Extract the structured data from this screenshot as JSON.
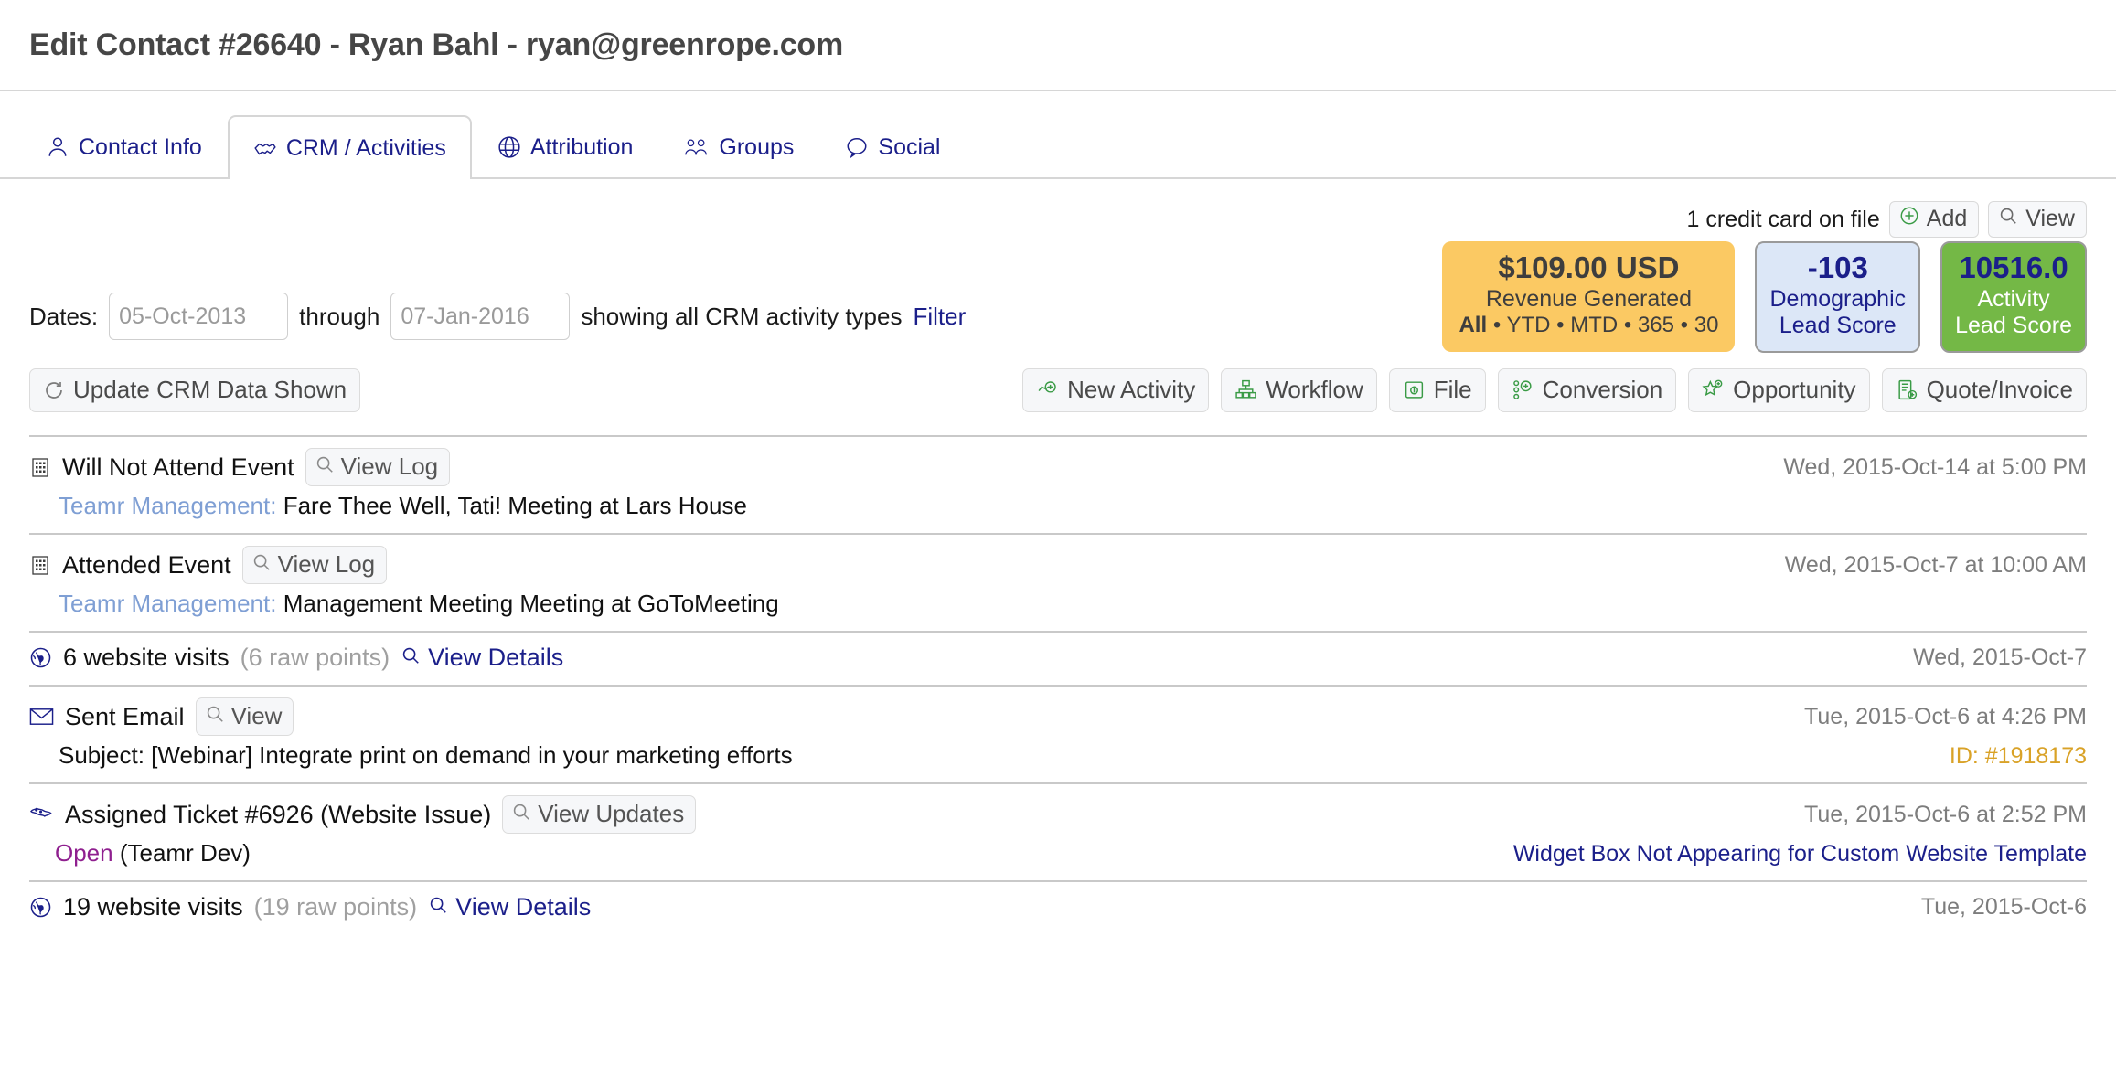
{
  "header": {
    "title": "Edit Contact #26640 - Ryan Bahl - ryan@greenrope.com"
  },
  "tabs": [
    {
      "label": "Contact Info",
      "icon": "person-icon",
      "active": false
    },
    {
      "label": "CRM / Activities",
      "icon": "handshake-icon",
      "active": true
    },
    {
      "label": "Attribution",
      "icon": "globe-icon",
      "active": false
    },
    {
      "label": "Groups",
      "icon": "people-icon",
      "active": false
    },
    {
      "label": "Social",
      "icon": "speech-bubble-icon",
      "active": false
    }
  ],
  "credit_card": {
    "text": "1 credit card on file",
    "add_label": "Add",
    "view_label": "View"
  },
  "dates": {
    "label": "Dates:",
    "from_value": "05-Oct-2013",
    "through_label": "through",
    "to_value": "07-Jan-2016",
    "showing_text": "showing all CRM activity types",
    "filter_label": "Filter"
  },
  "badges": {
    "revenue": {
      "amount": "$109.00 USD",
      "caption": "Revenue Generated",
      "ranges": [
        "All",
        "YTD",
        "MTD",
        "365",
        "30"
      ],
      "separator": "•",
      "bg": "#fbc963"
    },
    "demographic": {
      "value": "-103",
      "line1": "Demographic",
      "line2": "Lead Score",
      "bg": "#dce7f7"
    },
    "activity": {
      "value": "10516.0",
      "line1": "Activity",
      "line2": "Lead Score",
      "bg": "#74b846"
    }
  },
  "toolbar": {
    "update_label": "Update CRM Data Shown",
    "update_icon": "refresh-icon",
    "actions": [
      {
        "label": "New Activity",
        "icon": "new-activity-icon"
      },
      {
        "label": "Workflow",
        "icon": "workflow-icon"
      },
      {
        "label": "File",
        "icon": "file-icon"
      },
      {
        "label": "Conversion",
        "icon": "conversion-icon"
      },
      {
        "label": "Opportunity",
        "icon": "opportunity-star-icon"
      },
      {
        "label": "Quote/Invoice",
        "icon": "quote-invoice-icon"
      }
    ]
  },
  "activities": [
    {
      "type": "event",
      "icon": "calendar-icon",
      "title": "Will Not Attend Event",
      "button": "View Log",
      "date": "Wed, 2015-Oct-14 at 5:00 PM",
      "sub_group": "Teamr Management:",
      "sub_text": "Fare Thee Well, Tati! Meeting at Lars House",
      "sub_right": ""
    },
    {
      "type": "event",
      "icon": "calendar-icon",
      "title": "Attended Event",
      "button": "View Log",
      "date": "Wed, 2015-Oct-7 at 10:00 AM",
      "sub_group": "Teamr Management:",
      "sub_text": "Management Meeting Meeting at GoToMeeting",
      "sub_right": ""
    },
    {
      "type": "visits",
      "icon": "globe-icon",
      "title": "6 website visits",
      "raw_points": "(6 raw points)",
      "link": "View Details",
      "date": "Wed, 2015-Oct-7"
    },
    {
      "type": "email",
      "icon": "envelope-icon",
      "title": "Sent Email",
      "button": "View",
      "date": "Tue, 2015-Oct-6 at 4:26 PM",
      "sub_text": "Subject: [Webinar] Integrate print on demand in your marketing efforts",
      "sub_right": "ID: #1918173"
    },
    {
      "type": "ticket",
      "icon": "ticket-icon",
      "title": "Assigned Ticket #6926 (Website Issue)",
      "button": "View Updates",
      "date": "Tue, 2015-Oct-6 at 2:52 PM",
      "status": "Open",
      "sub_text": "(Teamr Dev)",
      "sub_right": "Widget Box Not Appearing for Custom Website Template"
    },
    {
      "type": "visits",
      "icon": "globe-icon",
      "title": "19 website visits",
      "raw_points": "(19 raw points)",
      "link": "View Details",
      "date": "Tue, 2015-Oct-6"
    }
  ]
}
